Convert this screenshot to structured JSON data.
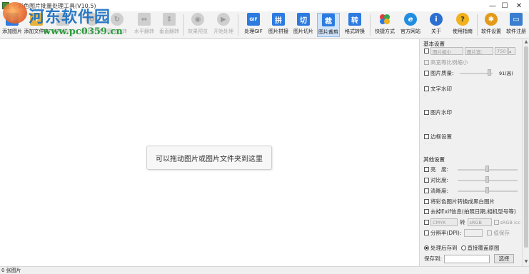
{
  "window": {
    "title": "七彩色图片批量处理工具(V10.5)",
    "minimize": "—",
    "maximize": "☐",
    "close": "✕"
  },
  "watermark": {
    "title": "河东软件园",
    "url": "www.pc0359.cn"
  },
  "toolbar": {
    "items": [
      {
        "label": "添加图片",
        "icon": "add-image-icon",
        "enabled": true
      },
      {
        "label": "添加文件夹",
        "icon": "add-folder-icon",
        "enabled": true
      },
      {
        "label": "移除图片",
        "icon": "remove-image-icon",
        "enabled": false
      },
      {
        "label": "图片左转",
        "icon": "rotate-left-icon",
        "enabled": false
      },
      {
        "label": "图片右转",
        "icon": "rotate-right-icon",
        "enabled": false
      },
      {
        "label": "水平翻转",
        "icon": "flip-horizontal-icon",
        "enabled": false
      },
      {
        "label": "垂直翻转",
        "icon": "flip-vertical-icon",
        "enabled": false
      },
      {
        "label": "效果预览",
        "icon": "preview-icon",
        "enabled": false
      },
      {
        "label": "开始处理",
        "icon": "start-icon",
        "enabled": false
      },
      {
        "label": "处理GIF",
        "icon": "gif-icon",
        "glyph": "GIF",
        "enabled": true
      },
      {
        "label": "图片拼接",
        "icon": "stitch-icon",
        "glyph": "拼",
        "enabled": true
      },
      {
        "label": "图片切片",
        "icon": "slice-icon",
        "glyph": "切",
        "enabled": true
      },
      {
        "label": "图片裁剪",
        "icon": "crop-icon",
        "glyph": "裁",
        "enabled": true
      },
      {
        "label": "格式转换",
        "icon": "convert-icon",
        "glyph": "转",
        "enabled": true
      },
      {
        "label": "快捷方式",
        "icon": "shortcut-icon",
        "enabled": true
      },
      {
        "label": "官方网站",
        "icon": "website-icon",
        "glyph": "e",
        "enabled": true
      },
      {
        "label": "关于",
        "icon": "about-icon",
        "glyph": "i",
        "enabled": true
      },
      {
        "label": "使用指南",
        "icon": "help-icon",
        "glyph": "?",
        "enabled": true
      },
      {
        "label": "软件设置",
        "icon": "settings-icon",
        "enabled": true
      },
      {
        "label": "软件注册",
        "icon": "register-icon",
        "enabled": true
      }
    ]
  },
  "droparea": {
    "hint": "可以拖动图片或图片文件夹到这里"
  },
  "panel": {
    "basic_title": "基本设置",
    "width_select": "图片缩小",
    "height_select": "图片宽:",
    "width_value": "750",
    "keep_ratio": "高宽等比例缩小",
    "quality_label": "图片质量:",
    "quality_value": "91(高)",
    "text_watermark": "文字水印",
    "image_watermark": "图片水印",
    "border": "边框设置",
    "other_title": "其他设置",
    "brightness": "亮　度:",
    "contrast": "对比度:",
    "saturation": "清晰度:",
    "grayscale": "将彩色图片转换成黑白图片",
    "remove_exif": "去掉Exif信息(拍照日期,相机型号等)",
    "from_format": "CMYK",
    "to_label": "转",
    "to_format": "sRGB",
    "icc_label": "sRGB icc",
    "dpi_label": "分辨率(DPI):",
    "lossless": "值保存",
    "save_to_folder": "处理后存到",
    "overwrite": "直接覆盖原图",
    "save_path_label": "保存到:",
    "save_path_value": "",
    "browse": "选择"
  },
  "status": {
    "text": "0 张图片"
  }
}
